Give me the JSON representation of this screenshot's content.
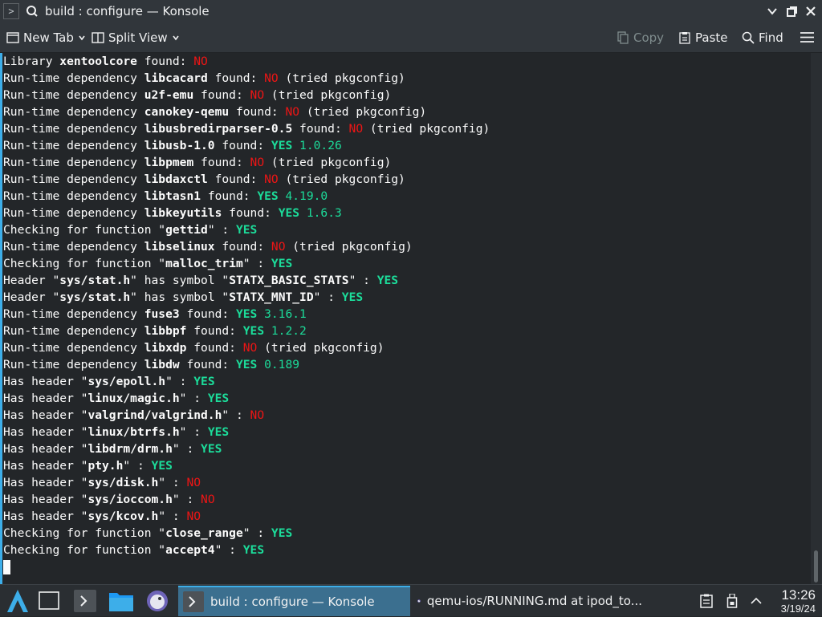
{
  "window": {
    "title": "build : configure — Konsole"
  },
  "toolbar": {
    "new_tab": "New Tab",
    "split_view": "Split View",
    "copy": "Copy",
    "paste": "Paste",
    "find": "Find"
  },
  "terminal": {
    "lines": [
      [
        [
          "Library ",
          ""
        ],
        [
          "xentoolcore",
          "b"
        ],
        [
          " found: ",
          ""
        ],
        [
          "NO",
          "no"
        ]
      ],
      [
        [
          "Run-time dependency ",
          ""
        ],
        [
          "libcacard",
          "b"
        ],
        [
          " found: ",
          ""
        ],
        [
          "NO",
          "no"
        ],
        [
          " (tried pkgconfig)",
          ""
        ]
      ],
      [
        [
          "Run-time dependency ",
          ""
        ],
        [
          "u2f-emu",
          "b"
        ],
        [
          " found: ",
          ""
        ],
        [
          "NO",
          "no"
        ],
        [
          " (tried pkgconfig)",
          ""
        ]
      ],
      [
        [
          "Run-time dependency ",
          ""
        ],
        [
          "canokey-qemu",
          "b"
        ],
        [
          " found: ",
          ""
        ],
        [
          "NO",
          "no"
        ],
        [
          " (tried pkgconfig)",
          ""
        ]
      ],
      [
        [
          "Run-time dependency ",
          ""
        ],
        [
          "libusbredirparser-0.5",
          "b"
        ],
        [
          " found: ",
          ""
        ],
        [
          "NO",
          "no"
        ],
        [
          " (tried pkgconfig)",
          ""
        ]
      ],
      [
        [
          "Run-time dependency ",
          ""
        ],
        [
          "libusb-1.0",
          "b"
        ],
        [
          " found: ",
          ""
        ],
        [
          "YES",
          "yes"
        ],
        [
          " 1.0.26",
          "ver"
        ]
      ],
      [
        [
          "Run-time dependency ",
          ""
        ],
        [
          "libpmem",
          "b"
        ],
        [
          " found: ",
          ""
        ],
        [
          "NO",
          "no"
        ],
        [
          " (tried pkgconfig)",
          ""
        ]
      ],
      [
        [
          "Run-time dependency ",
          ""
        ],
        [
          "libdaxctl",
          "b"
        ],
        [
          " found: ",
          ""
        ],
        [
          "NO",
          "no"
        ],
        [
          " (tried pkgconfig)",
          ""
        ]
      ],
      [
        [
          "Run-time dependency ",
          ""
        ],
        [
          "libtasn1",
          "b"
        ],
        [
          " found: ",
          ""
        ],
        [
          "YES",
          "yes"
        ],
        [
          " 4.19.0",
          "ver"
        ]
      ],
      [
        [
          "Run-time dependency ",
          ""
        ],
        [
          "libkeyutils",
          "b"
        ],
        [
          " found: ",
          ""
        ],
        [
          "YES",
          "yes"
        ],
        [
          " 1.6.3",
          "ver"
        ]
      ],
      [
        [
          "Checking for function \"",
          ""
        ],
        [
          "gettid",
          "b"
        ],
        [
          "\" : ",
          ""
        ],
        [
          "YES",
          "yes"
        ]
      ],
      [
        [
          "Run-time dependency ",
          ""
        ],
        [
          "libselinux",
          "b"
        ],
        [
          " found: ",
          ""
        ],
        [
          "NO",
          "no"
        ],
        [
          " (tried pkgconfig)",
          ""
        ]
      ],
      [
        [
          "Checking for function \"",
          ""
        ],
        [
          "malloc_trim",
          "b"
        ],
        [
          "\" : ",
          ""
        ],
        [
          "YES",
          "yes"
        ]
      ],
      [
        [
          "Header \"",
          ""
        ],
        [
          "sys/stat.h",
          "b"
        ],
        [
          "\" has symbol \"",
          ""
        ],
        [
          "STATX_BASIC_STATS",
          "b"
        ],
        [
          "\" : ",
          ""
        ],
        [
          "YES",
          "yes"
        ]
      ],
      [
        [
          "Header \"",
          ""
        ],
        [
          "sys/stat.h",
          "b"
        ],
        [
          "\" has symbol \"",
          ""
        ],
        [
          "STATX_MNT_ID",
          "b"
        ],
        [
          "\" : ",
          ""
        ],
        [
          "YES",
          "yes"
        ]
      ],
      [
        [
          "Run-time dependency ",
          ""
        ],
        [
          "fuse3",
          "b"
        ],
        [
          " found: ",
          ""
        ],
        [
          "YES",
          "yes"
        ],
        [
          " 3.16.1",
          "ver"
        ]
      ],
      [
        [
          "Run-time dependency ",
          ""
        ],
        [
          "libbpf",
          "b"
        ],
        [
          " found: ",
          ""
        ],
        [
          "YES",
          "yes"
        ],
        [
          " 1.2.2",
          "ver"
        ]
      ],
      [
        [
          "Run-time dependency ",
          ""
        ],
        [
          "libxdp",
          "b"
        ],
        [
          " found: ",
          ""
        ],
        [
          "NO",
          "no"
        ],
        [
          " (tried pkgconfig)",
          ""
        ]
      ],
      [
        [
          "Run-time dependency ",
          ""
        ],
        [
          "libdw",
          "b"
        ],
        [
          " found: ",
          ""
        ],
        [
          "YES",
          "yes"
        ],
        [
          " 0.189",
          "ver"
        ]
      ],
      [
        [
          "Has header \"",
          ""
        ],
        [
          "sys/epoll.h",
          "b"
        ],
        [
          "\" : ",
          ""
        ],
        [
          "YES",
          "yes"
        ]
      ],
      [
        [
          "Has header \"",
          ""
        ],
        [
          "linux/magic.h",
          "b"
        ],
        [
          "\" : ",
          ""
        ],
        [
          "YES",
          "yes"
        ]
      ],
      [
        [
          "Has header \"",
          ""
        ],
        [
          "valgrind/valgrind.h",
          "b"
        ],
        [
          "\" : ",
          ""
        ],
        [
          "NO",
          "no"
        ]
      ],
      [
        [
          "Has header \"",
          ""
        ],
        [
          "linux/btrfs.h",
          "b"
        ],
        [
          "\" : ",
          ""
        ],
        [
          "YES",
          "yes"
        ]
      ],
      [
        [
          "Has header \"",
          ""
        ],
        [
          "libdrm/drm.h",
          "b"
        ],
        [
          "\" : ",
          ""
        ],
        [
          "YES",
          "yes"
        ]
      ],
      [
        [
          "Has header \"",
          ""
        ],
        [
          "pty.h",
          "b"
        ],
        [
          "\" : ",
          ""
        ],
        [
          "YES",
          "yes"
        ]
      ],
      [
        [
          "Has header \"",
          ""
        ],
        [
          "sys/disk.h",
          "b"
        ],
        [
          "\" : ",
          ""
        ],
        [
          "NO",
          "no"
        ]
      ],
      [
        [
          "Has header \"",
          ""
        ],
        [
          "sys/ioccom.h",
          "b"
        ],
        [
          "\" : ",
          ""
        ],
        [
          "NO",
          "no"
        ]
      ],
      [
        [
          "Has header \"",
          ""
        ],
        [
          "sys/kcov.h",
          "b"
        ],
        [
          "\" : ",
          ""
        ],
        [
          "NO",
          "no"
        ]
      ],
      [
        [
          "Checking for function \"",
          ""
        ],
        [
          "close_range",
          "b"
        ],
        [
          "\" : ",
          ""
        ],
        [
          "YES",
          "yes"
        ]
      ],
      [
        [
          "Checking for function \"",
          ""
        ],
        [
          "accept4",
          "b"
        ],
        [
          "\" : ",
          ""
        ],
        [
          "YES",
          "yes"
        ]
      ]
    ]
  },
  "taskbar": {
    "tasks": [
      "build : configure — Konsole",
      "qemu-ios/RUNNING.md at ipod_to..."
    ],
    "clock": {
      "time": "13:26",
      "date": "3/19/24"
    }
  }
}
